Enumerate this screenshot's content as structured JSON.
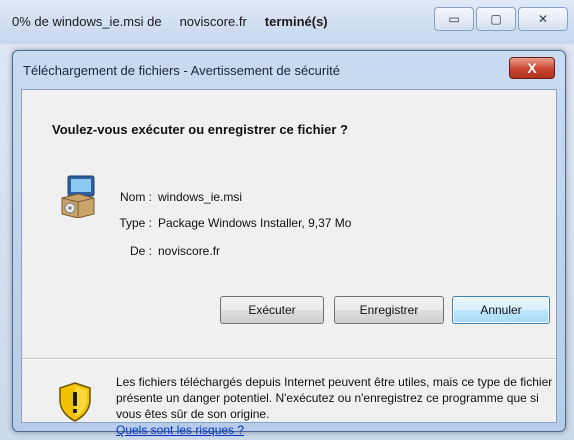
{
  "background_window": {
    "title_percent": "0% de windows_ie.msi de",
    "title_host": "noviscore.fr",
    "title_status": "terminé(s)",
    "controls": {
      "minimize_glyph": "▭",
      "maximize_glyph": "▢",
      "close_glyph": "✕"
    }
  },
  "dialog": {
    "title": "Téléchargement de fichiers - Avertissement de sécurité",
    "close_glyph": "X",
    "headline": "Voulez-vous exécuter ou enregistrer ce fichier ?",
    "file_icon": "installer-package-icon",
    "fields": [
      {
        "label": "Nom :",
        "value": "windows_ie.msi"
      },
      {
        "label": "Type :",
        "value": "Package Windows Installer, 9,37 Mo"
      },
      {
        "label": "De :",
        "value": "noviscore.fr"
      }
    ],
    "buttons": {
      "run": "Exécuter",
      "save": "Enregistrer",
      "cancel": "Annuler"
    },
    "warning": {
      "icon": "shield-warning-icon",
      "text": "Les fichiers téléchargés depuis Internet peuvent être utiles, mais ce type de fichier présente un danger potentiel. N'exécutez ou n'enregistrez ce programme que si vous êtes sûr de son origine.",
      "link": "Quels sont les risques ?"
    }
  },
  "colors": {
    "accent_button_border": "#3c7fb1",
    "close_button": "#c7442e",
    "link": "#0033cc",
    "shield_yellow": "#f2c200"
  }
}
